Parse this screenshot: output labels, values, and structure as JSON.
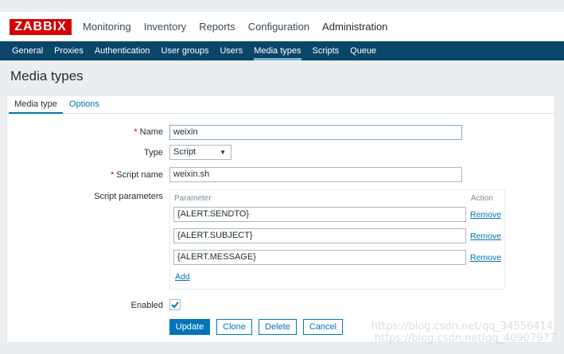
{
  "app": {
    "logo": "ZABBIX"
  },
  "top_menu": [
    "Monitoring",
    "Inventory",
    "Reports",
    "Configuration",
    "Administration"
  ],
  "sub_menu": [
    "General",
    "Proxies",
    "Authentication",
    "User groups",
    "Users",
    "Media types",
    "Scripts",
    "Queue"
  ],
  "page": {
    "title": "Media types"
  },
  "form": {
    "tabs": [
      "Media type",
      "Options"
    ],
    "required_mark": "*",
    "name_label": "Name",
    "name_value": "weixin",
    "type_label": "Type",
    "type_value": "Script",
    "script_name_label": "Script name",
    "script_name_value": "weixin.sh",
    "script_params_label": "Script parameters",
    "params": {
      "col_parameter": "Parameter",
      "col_action": "Action",
      "rows": [
        {
          "value": "{ALERT.SENDTO}",
          "action": "Remove"
        },
        {
          "value": "{ALERT.SUBJECT}",
          "action": "Remove"
        },
        {
          "value": "{ALERT.MESSAGE}",
          "action": "Remove"
        }
      ],
      "add_label": "Add"
    },
    "enabled_label": "Enabled",
    "enabled": true,
    "buttons": {
      "update": "Update",
      "clone": "Clone",
      "delete": "Delete",
      "cancel": "Cancel"
    }
  },
  "watermark": [
    "https://blog.csdn.net/qq_34556414",
    "https://blog.csdn.net/qq_40907977"
  ],
  "colors": {
    "brand": "#d40000",
    "nav": "#0a466a",
    "accent": "#0275b8"
  }
}
